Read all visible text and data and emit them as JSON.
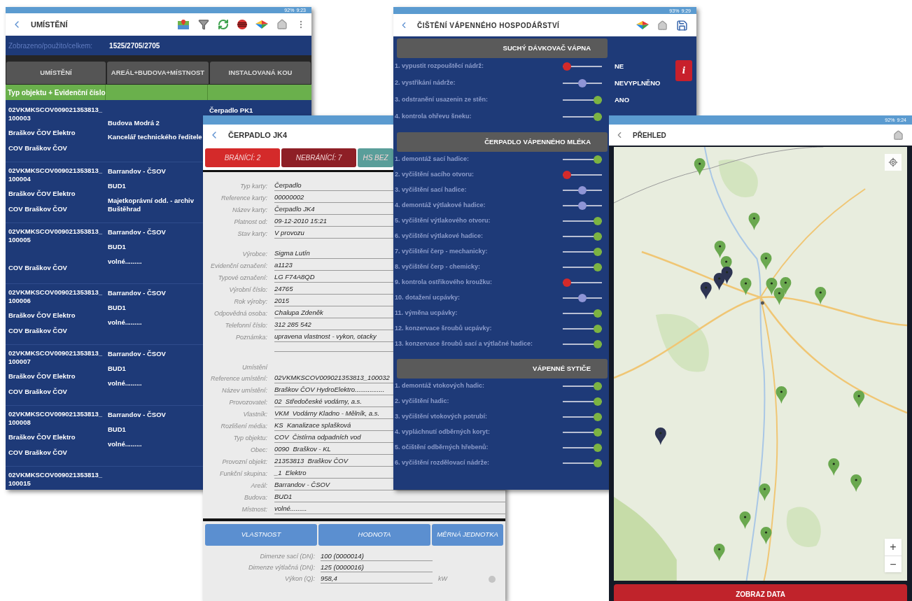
{
  "location_list": {
    "status_bar": {
      "battery": "92%",
      "time": "9:23"
    },
    "title": "UMÍSTĚNÍ",
    "counter_label": "Zobrazeno/použito/celkem:",
    "counter_value": "1525/2705/2705",
    "columns": [
      "UMÍSTĚNÍ",
      "AREÁL+BUDOVA+MÍSTNOST",
      "INSTALOVANÁ KOU"
    ],
    "filter_text": "Typ objektu + Evidenční číslo",
    "rows": [
      {
        "id": "02VKMKSCOV009021353813_100003",
        "unit": "Braškov ČOV Elektro",
        "object": "COV Braškov ČOV",
        "building": "Budova Modrá 2",
        "room": "Kancelář technického ředitele",
        "installed": "Čerpadlo PK1"
      },
      {
        "id": "02VKMKSCOV009021353813_100004",
        "unit": "Braškov ČOV Elektro",
        "object": "COV Braškov ČOV",
        "area": "Barrandov - ČSOV",
        "building": "BUD1",
        "room": "Majetkoprávní odd. - archiv Buštěhrad"
      },
      {
        "id": "02VKMKSCOV009021353813_100005",
        "object": "COV Braškov ČOV",
        "area": "Barrandov - ČSOV",
        "building": "BUD1",
        "room": "volné........."
      },
      {
        "id": "02VKMKSCOV009021353813_100006",
        "unit": "Braškov ČOV Elektro",
        "object": "COV Braškov ČOV",
        "area": "Barrandov - ČSOV",
        "building": "BUD1",
        "room": "volné........."
      },
      {
        "id": "02VKMKSCOV009021353813_100007",
        "unit": "Braškov ČOV Elektro",
        "object": "COV Braškov ČOV",
        "area": "Barrandov - ČSOV",
        "building": "BUD1",
        "room": "volné........."
      },
      {
        "id": "02VKMKSCOV009021353813_100008",
        "unit": "Braškov ČOV Elektro",
        "object": "COV Braškov ČOV",
        "area": "Barrandov - ČSOV",
        "building": "BUD1",
        "room": "volné........."
      },
      {
        "id": "02VKMKSCOV009021353813_100015"
      }
    ]
  },
  "pump_card": {
    "title": "ČERPADLO JK4",
    "tabs": [
      {
        "label": "BRÁNÍCÍ: 2",
        "color": "#d42a2a"
      },
      {
        "label": "NEBRÁNÍCÍ: 7",
        "color": "#8e1f26"
      },
      {
        "label": "HS BEZ",
        "color": "#5a9e9a"
      }
    ],
    "card_fields": [
      {
        "label": "Typ karty:",
        "value": "Čerpadlo"
      },
      {
        "label": "Reference karty:",
        "value": "00000002"
      },
      {
        "label": "Název karty:",
        "value": "Čerpadlo JK4"
      },
      {
        "label": "Platnost od:",
        "value": "09-12-2010 15:21"
      },
      {
        "label": "Stav karty:",
        "value": "V provozu"
      }
    ],
    "device_fields": [
      {
        "label": "Výrobce:",
        "value": "Sigma Lutín"
      },
      {
        "label": "Evidenční označení:",
        "value": "a1123"
      },
      {
        "label": "Typové označení:",
        "value": "LG F74A8QD"
      },
      {
        "label": "Výrobní číslo:",
        "value": "24765"
      },
      {
        "label": "Rok výroby:",
        "value": "2015"
      },
      {
        "label": "Odpovědná osoba:",
        "value": "Chalupa Zdeněk"
      },
      {
        "label": "Telefonní číslo:",
        "value": "312 285 542"
      },
      {
        "label": "Poznámka:",
        "value": "upravena vlastnost - vykon, otacky"
      }
    ],
    "location_heading": "Umístění",
    "location_fields": [
      {
        "label": "Reference umístění:",
        "value": "02VKMKSCOV009021353813_100032"
      },
      {
        "label": "Název umístění:",
        "value": "Braškov ČOV HydroElektro................"
      },
      {
        "label": "Provozovatel:",
        "value": "02  Středočeské vodárny, a.s."
      },
      {
        "label": "Vlastník:",
        "value": "VKM  Vodárny Kladno - Mělník, a.s."
      },
      {
        "label": "Rozlišení média:",
        "value": "KS  Kanalizace splašková"
      },
      {
        "label": "Typ objektu:",
        "value": "COV  Čistírna odpadních vod"
      },
      {
        "label": "Obec:",
        "value": "0090  Braškov - KL"
      },
      {
        "label": "Provozní objekt:",
        "value": "21353813  Braškov ČOV"
      },
      {
        "label": "Funkční skupina:",
        "value": "_1  Elektro"
      },
      {
        "label": "Areál:",
        "value": "Barrandov - ČSOV"
      },
      {
        "label": "Budova:",
        "value": "BUD1"
      },
      {
        "label": "Místnost:",
        "value": "volné........."
      }
    ],
    "property_columns": [
      "VLASTNOST",
      "HODNOTA",
      "MĚRNÁ JEDNOTKA"
    ],
    "properties": [
      {
        "label": "Dimenze sací (DN):",
        "value": "100 (0000014)"
      },
      {
        "label": "Dimenze výtlačná (DN):",
        "value": "125 (0000016)"
      },
      {
        "label": "Výkon (Q):",
        "value": "958,4",
        "unit": "kW"
      }
    ]
  },
  "lime_cleaning": {
    "status_bar": {
      "battery": "93%",
      "time": "9:29"
    },
    "title": "ČIŠTĚNÍ VÁPENNÉHO HOSPODÁŘSTVÍ",
    "sections": [
      {
        "heading": "SUCHÝ DÁVKOVAČ VÁPNA",
        "info_button": "i",
        "items": [
          {
            "label": "1. vypustit rozpouštěcí nádrž:",
            "level": 0,
            "value": "NE"
          },
          {
            "label": "2. vystřikání nádrže:",
            "level": 0.5,
            "value": "NEVYPLNĚNO"
          },
          {
            "label": "3. odstranění usazenin ze stěn:",
            "level": 1,
            "value": "ANO"
          },
          {
            "label": "4. kontrola ohřevu šneku:",
            "level": 1
          }
        ]
      },
      {
        "heading": "ČERPADLO VÁPENNÉHO MLÉKA",
        "items": [
          {
            "label": "1. demontáž sací hadice:",
            "level": 1
          },
          {
            "label": "2. vyčištění sacího otvoru:",
            "level": 0
          },
          {
            "label": "3. vyčištění sací hadice:",
            "level": 0.5
          },
          {
            "label": "4. demontáž výtlakové hadice:",
            "level": 0.5
          },
          {
            "label": "5. vyčištění výtlakového otvoru:",
            "level": 1
          },
          {
            "label": "6. vyčištění výtlakové hadice:",
            "level": 1
          },
          {
            "label": "7. vyčištění čerp - mechanicky:",
            "level": 1
          },
          {
            "label": "8. vyčištění čerp - chemicky:",
            "level": 1
          },
          {
            "label": "9. kontrola ostřikového kroužku:",
            "level": 0
          },
          {
            "label": "10. dotažení ucpávky:",
            "level": 0.5
          },
          {
            "label": "11. výměna ucpávky:",
            "level": 1
          },
          {
            "label": "12. konzervace šroubů ucpávky:",
            "level": 1
          },
          {
            "label": "13. konzervace šroubů sací a výtlačné hadice:",
            "level": 1
          }
        ]
      },
      {
        "heading": "VÁPENNÉ SYTIČE",
        "items": [
          {
            "label": "1. demontáž vtokových hadic:",
            "level": 1
          },
          {
            "label": "2. vyčištění hadic:",
            "level": 1
          },
          {
            "label": "3. vyčištění vtokových potrubí:",
            "level": 1
          },
          {
            "label": "4. vypláchnutí odběrných koryt:",
            "level": 1
          },
          {
            "label": "5. očištění odběrných hřebenů:",
            "level": 1
          },
          {
            "label": "6. vyčištění rozdělovací nádrže:",
            "level": 1
          }
        ]
      }
    ]
  },
  "overview": {
    "status_bar": {
      "battery": "92%",
      "time": "9:24"
    },
    "title": "PŘEHLED",
    "zoom_in": "+",
    "zoom_out": "−",
    "button": "ZOBRAZ DATA"
  }
}
